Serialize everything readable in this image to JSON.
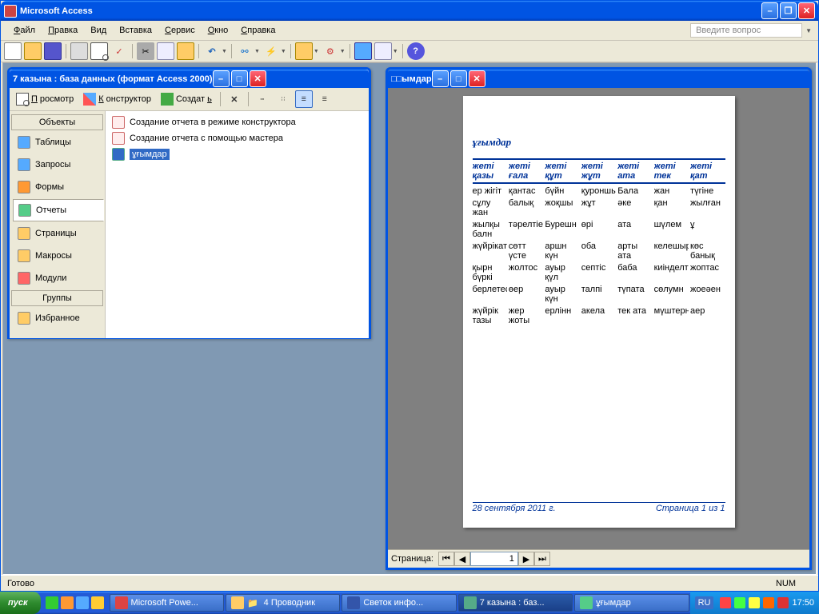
{
  "app": {
    "title": "Microsoft Access"
  },
  "menu": {
    "file": "Файл",
    "edit": "Правка",
    "view": "Вид",
    "insert": "Вставка",
    "service": "Сервис",
    "window": "Окно",
    "help": "Справка",
    "question_placeholder": "Введите вопрос"
  },
  "db_window": {
    "title": "7 казына : база данных (формат Access 2000)",
    "tb_preview": "Просмотр",
    "tb_design": "Конструктор",
    "tb_create": "Создать",
    "group_objects": "Объекты",
    "group_groups": "Группы",
    "nav": {
      "tables": "Таблицы",
      "queries": "Запросы",
      "forms": "Формы",
      "reports": "Отчеты",
      "pages": "Страницы",
      "macros": "Макросы",
      "modules": "Модули",
      "favorites": "Избранное"
    },
    "list": {
      "design_mode": "Создание отчета в режиме конструктора",
      "wizard": "Создание отчета с помощью мастера",
      "report1": "ұғымдар"
    }
  },
  "report_window": {
    "title": "□□ымдар",
    "page_title": "ұғымдар",
    "cols": [
      "жеті қазы",
      "жеті ғала",
      "жеті құт",
      "жеті жұт",
      "жеті ата",
      "жеті тек",
      "жеті қат"
    ],
    "rows": [
      [
        "ер жігіт",
        "қантас",
        "бүйн",
        "қуроншылық",
        "Бала",
        "жан",
        "түгіне"
      ],
      [
        "сұлу жан",
        "балық",
        "жоқшы",
        "жұт",
        "әке",
        "қан",
        "жылған"
      ],
      [
        "жылқы балн",
        "тәрелтіе",
        "Бурешн",
        "өрі",
        "ата",
        "шүлем",
        "ұ"
      ],
      [
        "жүйрікат",
        "сөтт үсте",
        "аршн күн",
        "оба",
        "арты ата",
        "келешырып",
        "көс банық"
      ],
      [
        "қырн бүркі",
        "жолтос",
        "ауыр қүл",
        "септіс",
        "баба",
        "киінделтік",
        "жоптас"
      ],
      [
        "берлетесқ",
        "өер",
        "ауыр күн",
        "талпі",
        "түпата",
        "сөлумн",
        "жоеәен"
      ],
      [
        "жүйрік тазы",
        "жер жоты",
        "ерлінн",
        "акела",
        "тек ата",
        "мүштерн",
        "аер"
      ]
    ],
    "footer_date": "28 сентября 2011 г.",
    "footer_page": "Страница 1 из 1",
    "pager_label": "Страница:",
    "pager_value": "1"
  },
  "statusbar": {
    "ready": "Готово",
    "num": "NUM"
  },
  "taskbar": {
    "start": "пуск",
    "tasks": [
      "Microsoft Powe...",
      "4 Проводник",
      "Светок инфо...",
      "7 казына : баз...",
      "ұғымдар"
    ],
    "lang": "RU",
    "clock": "17:50"
  }
}
